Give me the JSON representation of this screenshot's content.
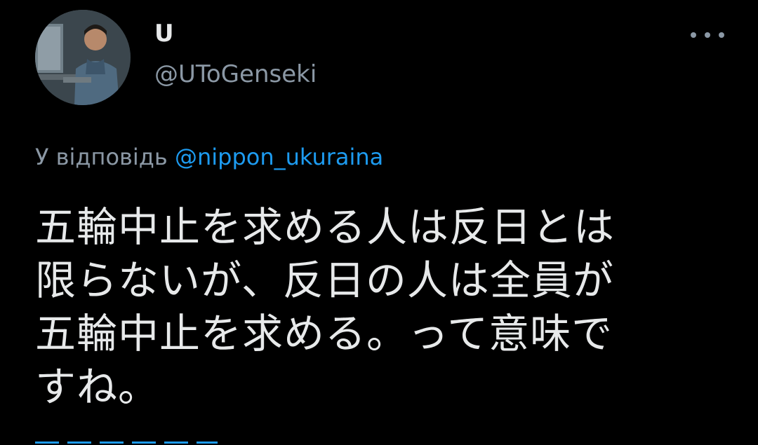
{
  "author": {
    "display_name": "U",
    "handle": "@UToGenseki",
    "avatar_icon": "profile-photo"
  },
  "more_icon": "more-horizontal-icon",
  "reply": {
    "prefix": "У відповідь",
    "mention": "@nippon_ukuraina"
  },
  "tweet": {
    "lines": [
      "五輪中止を求める人は反日とは",
      "限らないが、反日の人は全員が",
      "五輪中止を求める。って意味で",
      "すね。"
    ]
  },
  "colors": {
    "background": "#000000",
    "text": "#e7e9ea",
    "secondary": "#8b98a5",
    "link": "#1d9bf0"
  }
}
